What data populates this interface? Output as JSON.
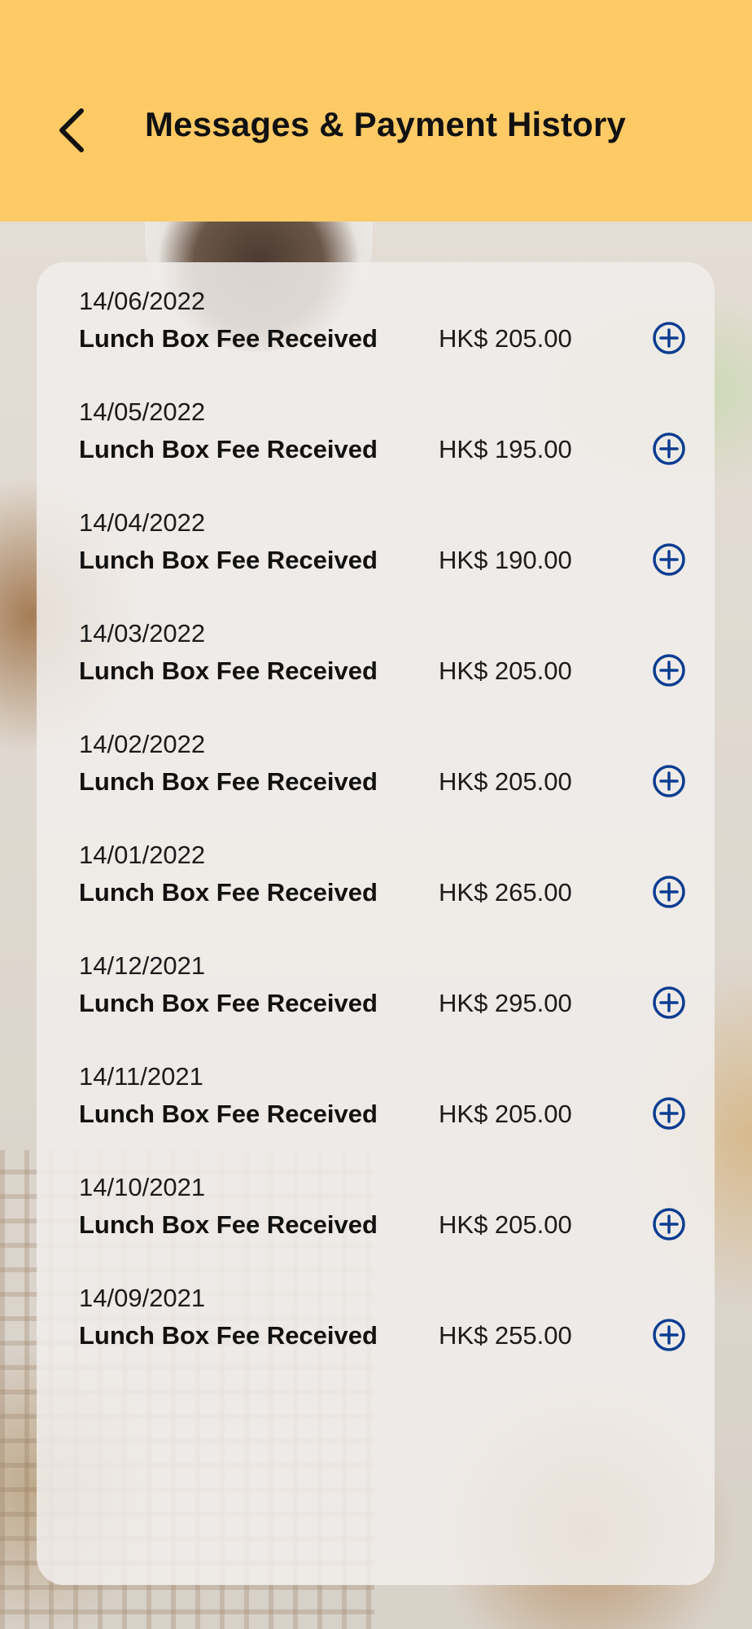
{
  "header": {
    "title": "Messages & Payment History",
    "back_icon": "chevron-left-icon",
    "background_color": "#fdca66"
  },
  "accent_color": "#0b3d91",
  "payments": [
    {
      "date": "14/06/2022",
      "title": "Lunch Box Fee Received",
      "amount": "HK$ 205.00",
      "action_icon": "plus-circle-icon"
    },
    {
      "date": "14/05/2022",
      "title": "Lunch Box Fee Received",
      "amount": "HK$ 195.00",
      "action_icon": "plus-circle-icon"
    },
    {
      "date": "14/04/2022",
      "title": "Lunch Box Fee Received",
      "amount": "HK$ 190.00",
      "action_icon": "plus-circle-icon"
    },
    {
      "date": "14/03/2022",
      "title": "Lunch Box Fee Received",
      "amount": "HK$ 205.00",
      "action_icon": "plus-circle-icon"
    },
    {
      "date": "14/02/2022",
      "title": "Lunch Box Fee Received",
      "amount": "HK$ 205.00",
      "action_icon": "plus-circle-icon"
    },
    {
      "date": "14/01/2022",
      "title": "Lunch Box Fee Received",
      "amount": "HK$ 265.00",
      "action_icon": "plus-circle-icon"
    },
    {
      "date": "14/12/2021",
      "title": "Lunch Box Fee Received",
      "amount": "HK$ 295.00",
      "action_icon": "plus-circle-icon"
    },
    {
      "date": "14/11/2021",
      "title": "Lunch Box Fee Received",
      "amount": "HK$ 205.00",
      "action_icon": "plus-circle-icon"
    },
    {
      "date": "14/10/2021",
      "title": "Lunch Box Fee Received",
      "amount": "HK$ 205.00",
      "action_icon": "plus-circle-icon"
    },
    {
      "date": "14/09/2021",
      "title": "Lunch Box Fee Received",
      "amount": "HK$ 255.00",
      "action_icon": "plus-circle-icon"
    }
  ]
}
